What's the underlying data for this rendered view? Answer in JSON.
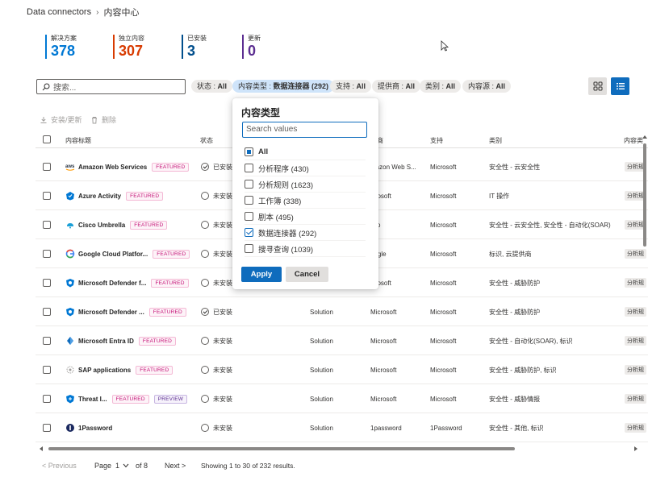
{
  "breadcrumb": {
    "root": "Data connectors",
    "current": "内容中心"
  },
  "metrics": [
    {
      "label": "解决方案",
      "value": "378",
      "color": "#0078d4"
    },
    {
      "label": "独立内容",
      "value": "307",
      "color": "#d83b01"
    },
    {
      "label": "已安装",
      "value": "3",
      "color": "#004e8c"
    },
    {
      "label": "更新",
      "value": "0",
      "color": "#5c2e91"
    }
  ],
  "search": {
    "placeholder": "搜索..."
  },
  "filters": [
    {
      "name": "状态",
      "value": "All"
    },
    {
      "name": "内容类型",
      "value": "数据连接器 (292)"
    },
    {
      "name": "支持",
      "value": "All"
    },
    {
      "name": "提供商",
      "value": "All"
    },
    {
      "name": "类别",
      "value": "All"
    },
    {
      "name": "内容源",
      "value": "All"
    }
  ],
  "actions": {
    "install": "安装/更新",
    "delete": "删除"
  },
  "columns": {
    "title": "内容标题",
    "status": "状态",
    "provider": "供商",
    "support": "支持",
    "category": "类别",
    "source": "内容类"
  },
  "rows": [
    {
      "name": "Amazon Web Services",
      "badge": "FEATURED",
      "status": "已安装",
      "content_type": "",
      "provider": "mazon Web S...",
      "support": "Microsoft",
      "category": "安全性 - 云安全性",
      "tag": "分析规"
    },
    {
      "name": "Azure Activity",
      "badge": "FEATURED",
      "status": "未安装",
      "content_type": "",
      "provider": "icrosoft",
      "support": "Microsoft",
      "category": "IT 操作",
      "tag": "分析规"
    },
    {
      "name": "Cisco Umbrella",
      "badge": "FEATURED",
      "status": "未安装",
      "content_type": "",
      "provider": "sco",
      "support": "Microsoft",
      "category": "安全性 - 云安全性, 安全性 - 自动化(SOAR)",
      "tag": "分析规"
    },
    {
      "name": "Google Cloud Platfor...",
      "badge": "FEATURED",
      "status": "未安装",
      "content_type": "",
      "provider": "oogle",
      "support": "Microsoft",
      "category": "标识, 云提供商",
      "tag": "分析规"
    },
    {
      "name": "Microsoft Defender f...",
      "badge": "FEATURED",
      "status": "未安装",
      "content_type": "",
      "provider": "icrosoft",
      "support": "Microsoft",
      "category": "安全性 - 威胁防护",
      "tag": "分析规"
    },
    {
      "name": "Microsoft Defender ...",
      "badge": "FEATURED",
      "status": "已安装",
      "content_type": "Solution",
      "provider": "Microsoft",
      "support": "Microsoft",
      "category": "安全性 - 威胁防护",
      "tag": "分析规"
    },
    {
      "name": "Microsoft Entra ID",
      "badge": "FEATURED",
      "status": "未安装",
      "content_type": "Solution",
      "provider": "Microsoft",
      "support": "Microsoft",
      "category": "安全性 - 自动化(SOAR), 标识",
      "tag": "分析规"
    },
    {
      "name": "SAP applications",
      "badge": "FEATURED",
      "status": "未安装",
      "content_type": "Solution",
      "provider": "Microsoft",
      "support": "Microsoft",
      "category": "安全性 - 威胁防护, 标识",
      "tag": "分析规"
    },
    {
      "name": "Threat I...",
      "badge": "FEATURED",
      "badge2": "PREVIEW",
      "status": "未安装",
      "content_type": "Solution",
      "provider": "Microsoft",
      "support": "Microsoft",
      "category": "安全性 - 威胁情报",
      "tag": "分析规"
    },
    {
      "name": "1Password",
      "badge": "",
      "status": "未安装",
      "content_type": "Solution",
      "provider": "1password",
      "support": "1Password",
      "category": "安全性 - 其他, 标识",
      "tag": "分析规"
    }
  ],
  "pagination": {
    "previous": "< Previous",
    "page_label": "Page",
    "page_value": "1",
    "of": "of 8",
    "next": "Next >",
    "summary": "Showing 1 to 30 of 232 results."
  },
  "dropdown": {
    "title": "内容类型",
    "search_placeholder": "Search values",
    "options": [
      {
        "label": "All",
        "state": "partial"
      },
      {
        "label": "分析程序 (430)",
        "state": "unchecked"
      },
      {
        "label": "分析规则 (1623)",
        "state": "unchecked"
      },
      {
        "label": "工作簿 (338)",
        "state": "unchecked"
      },
      {
        "label": "剧本 (495)",
        "state": "unchecked"
      },
      {
        "label": "数据连接器 (292)",
        "state": "checked"
      },
      {
        "label": "搜寻查询 (1039)",
        "state": "unchecked"
      }
    ],
    "apply": "Apply",
    "cancel": "Cancel"
  }
}
